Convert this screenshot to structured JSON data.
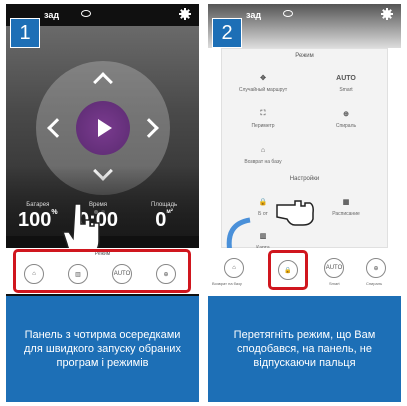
{
  "panel1": {
    "step": "1",
    "topbar": {
      "back_label": "зад"
    },
    "stats": [
      {
        "label": "Батарея",
        "value": "100",
        "unit": "%"
      },
      {
        "label": "Время",
        "value": "0:00",
        "unit": ""
      },
      {
        "label": "Площадь",
        "value": "0",
        "unit": "м²"
      }
    ],
    "mode_title": "Режим",
    "mode_icons": [
      "home-icon",
      "spiral-grid-icon",
      "AUTO",
      "target-icon"
    ],
    "caption": "Панель з чотирма осередками для швидкого запуску обраних програм і режимів"
  },
  "panel2": {
    "step": "2",
    "topbar": {
      "back_label": "зад"
    },
    "mode_section": "Режим",
    "mode_items": [
      {
        "label": "Случайный маршрут",
        "icon": "move-icon"
      },
      {
        "label": "Smart",
        "icon": "AUTO"
      },
      {
        "label": "Периметр",
        "icon": "perimeter-icon"
      },
      {
        "label": "Спираль",
        "icon": "target-icon"
      },
      {
        "label": "Возврат на базу",
        "icon": "home-icon"
      }
    ],
    "settings_section": "Настройки",
    "settings_items": [
      {
        "label": "Б от",
        "icon": "lock-icon"
      },
      {
        "label": "Расписание",
        "icon": "calendar-icon"
      },
      {
        "label": "Карта",
        "icon": "map-icon"
      }
    ],
    "bar_labels": [
      "Возврат на базу",
      "",
      "Smart",
      "Спираль"
    ],
    "bar_icons": [
      "home-icon",
      "lock-icon",
      "AUTO",
      "target-icon"
    ],
    "caption": "Перетягніть режим, що Вам сподобався, на панель, не відпускаючи пальця"
  },
  "colors": {
    "accent_blue": "#1d6fb6",
    "highlight_red": "#d0161e",
    "play_purple": "#6a2f80"
  }
}
